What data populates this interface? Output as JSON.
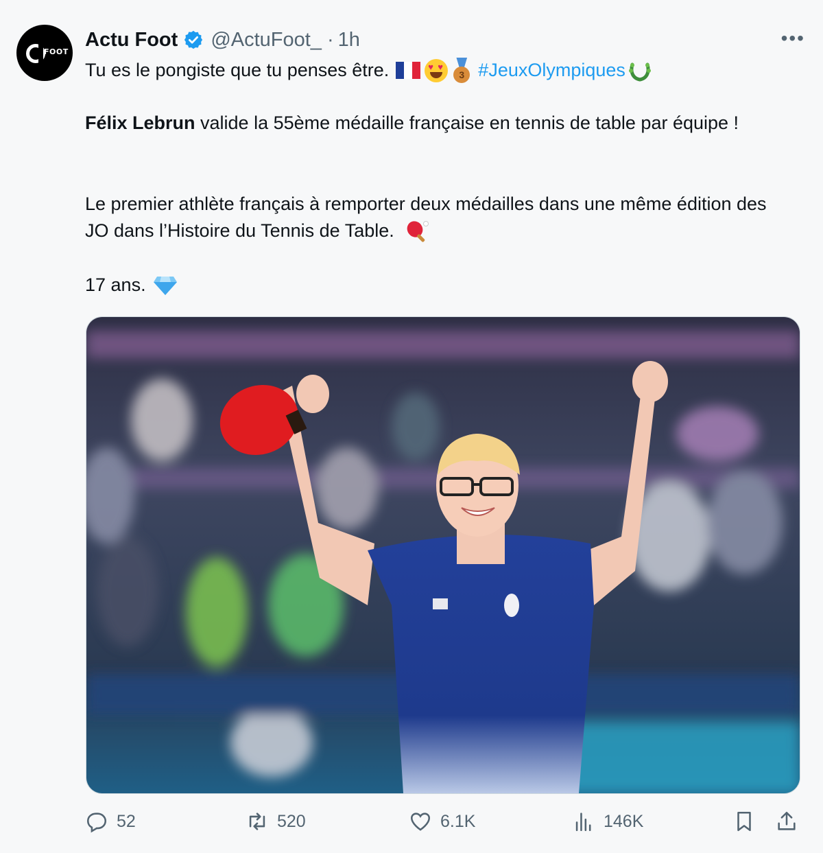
{
  "author": {
    "name": "Actu Foot",
    "handle": "@ActuFoot_",
    "separator": "·",
    "time": "1h",
    "avatar_text": "FOOT",
    "verified": true
  },
  "more_icon": "more-horizontal-icon",
  "tweet": {
    "line1_text": "Tu es le pongiste que tu penses être.",
    "line1_emojis": [
      "french-flag-icon",
      "heart-eyes-emoji-icon",
      "bronze-medal-icon"
    ],
    "medal_number": "3",
    "hashtag": "#JeuxOlympiques",
    "hashtag_emoji": "laurel-wreath-icon",
    "para2_bold": "Félix Lebrun",
    "para2_rest": " valide la 55ème médaille française en tennis de table par équipe !",
    "para3": "Le premier athlète français à remporter deux médailles dans une même édition des JO dans l’Histoire du Tennis de Table.",
    "para3_emoji": "ping-pong-icon",
    "para4": "17 ans.",
    "para4_emoji": "gem-icon"
  },
  "actions": {
    "replies": "52",
    "retweets": "520",
    "likes": "6.1K",
    "views": "146K"
  },
  "colors": {
    "link": "#1d9bf0",
    "text": "#0f1419",
    "secondary": "#536471",
    "background": "#f7f8f9"
  }
}
